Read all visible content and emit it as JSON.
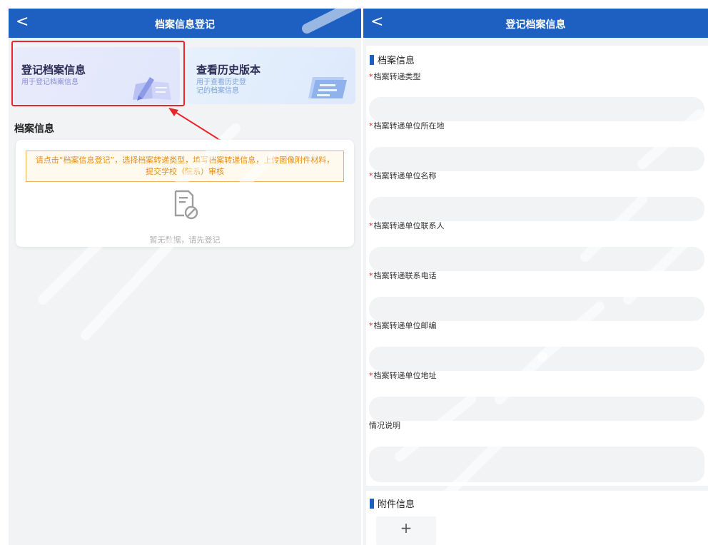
{
  "left_screen": {
    "navbar": {
      "back_glyph": "<",
      "title": "档案信息登记"
    },
    "cards": {
      "register": {
        "title": "登记档案信息",
        "desc": "用于登记档案信息",
        "icon": "register-illustration-icon"
      },
      "history": {
        "title": "查看历史版本",
        "desc": "用于查看历史登记的档案信息",
        "icon": "history-illustration-icon"
      }
    },
    "section_title": "档案信息",
    "notice": "请点击“档案信息登记”，选择档案转递类型，填写档案转递信息，上传图像附件材料，提交学校（院系）审核",
    "empty_state": {
      "icon": "empty-document-icon",
      "text": "暂无数据，请先登记"
    }
  },
  "right_screen": {
    "navbar": {
      "back_glyph": "<",
      "title": "登记档案信息"
    },
    "form_section_title": "档案信息",
    "fields": [
      {
        "label": "档案转递类型",
        "required": true,
        "value": ""
      },
      {
        "label": "档案转递单位所在地",
        "required": true,
        "value": ""
      },
      {
        "label": "档案转递单位名称",
        "required": true,
        "value": ""
      },
      {
        "label": "档案转递单位联系人",
        "required": true,
        "value": ""
      },
      {
        "label": "档案转递联系电话",
        "required": true,
        "value": ""
      },
      {
        "label": "档案转递单位邮编",
        "required": true,
        "value": ""
      },
      {
        "label": "档案转递单位地址",
        "required": true,
        "value": ""
      }
    ],
    "remarks": {
      "label": "情况说明",
      "value": ""
    },
    "required_mark": "*",
    "attachments": {
      "title": "附件信息",
      "add_glyph": "+"
    }
  },
  "colors": {
    "nav_blue": "#1e5fc2",
    "highlight_red": "#e8262b",
    "notice_orange": "#e58f1c",
    "page_bg": "#f2f3f5"
  }
}
